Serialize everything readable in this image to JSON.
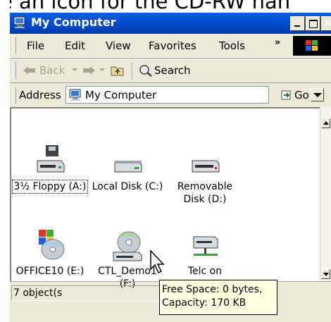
{
  "caption": "e an icon for the CD-RW han",
  "window": {
    "title": "My Computer",
    "icon": "my-computer-icon"
  },
  "menubar": {
    "items": [
      "File",
      "Edit",
      "View",
      "Favorites",
      "Tools"
    ],
    "overflow": "»"
  },
  "toolbar": {
    "back_label": "Back",
    "search_label": "Search"
  },
  "address": {
    "label": "Address",
    "value": "My Computer",
    "go_label": "Go"
  },
  "items": [
    {
      "label": "3½ Floppy (A:)",
      "icon": "floppy-drive-icon",
      "selected": true
    },
    {
      "label": "Local Disk (C:)",
      "icon": "hard-disk-icon"
    },
    {
      "label": "Removable Disk (D:)",
      "icon": "removable-disk-icon"
    },
    {
      "label": "OFFICE10 (E:)",
      "icon": "cd-drive-office-icon"
    },
    {
      "label": "CTL_Demo1 (F:)",
      "icon": "cd-drive-icon"
    },
    {
      "label": "Telc on",
      "icon": "network-drive-icon"
    }
  ],
  "status": {
    "text": "7 object(s"
  },
  "tooltip": {
    "line1": "Free Space: 0 bytes,",
    "line2": "Capacity: 170 KB"
  }
}
